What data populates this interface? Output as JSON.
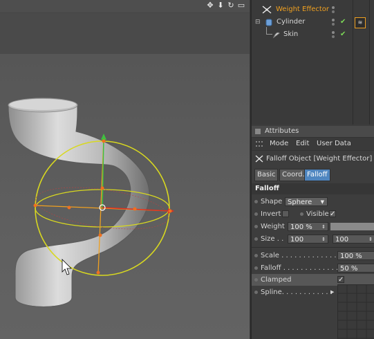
{
  "viewport": {
    "header_icons": [
      "move-icon",
      "down-arrow-icon",
      "rotate-icon",
      "maximize-icon"
    ]
  },
  "object_manager": {
    "objects": [
      {
        "name": "Weight Effector",
        "color": "#f0a020",
        "icon": "effector-icon"
      },
      {
        "name": "Cylinder",
        "color": "#d8d8d8",
        "icon": "cylinder-icon"
      },
      {
        "name": "Skin",
        "color": "#d8d8d8",
        "icon": "skin-icon"
      }
    ]
  },
  "attributes": {
    "title": "Attributes",
    "menu": [
      "Mode",
      "Edit",
      "User Data"
    ],
    "object_title": "Falloff Object [Weight Effector]",
    "tabs": [
      "Basic",
      "Coord.",
      "Falloff"
    ],
    "active_tab": "Falloff",
    "section": "Falloff",
    "shape_label": "Shape",
    "shape_value": "Sphere",
    "invert_label": "Invert",
    "visible_label": "Visible",
    "weight_label": "Weight",
    "weight_value": "100 %",
    "weight_fill": 1.0,
    "size_label": "Size . .",
    "size_x": "100",
    "size_y": "100",
    "scale_label": "Scale . . . . . . . . . . . . .",
    "scale_value": "100 %",
    "falloff_label": "Falloff . . . . . . . . . . . . .",
    "falloff_value": "50 %",
    "clamped_label": "Clamped",
    "spline_label": "Spline. . . . . . . . . . . ."
  },
  "colors": {
    "accent_tab": "#4f86c0",
    "effector_name": "#f0a020",
    "falloff_sphere": "#d8d820",
    "axis_x": "#e03020",
    "axis_y": "#40c040",
    "axis_z": "#f0a020"
  }
}
